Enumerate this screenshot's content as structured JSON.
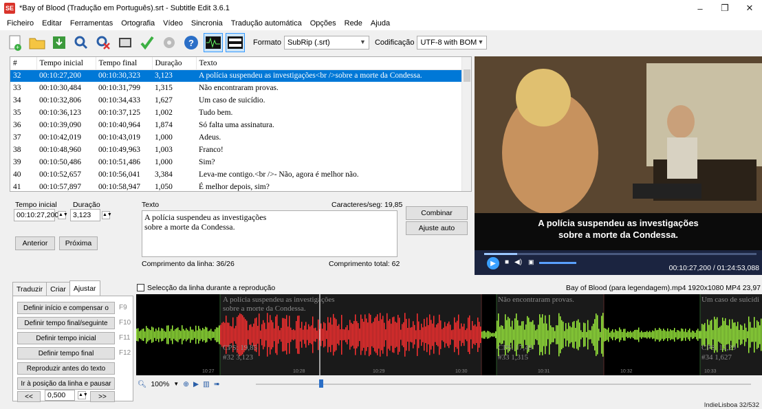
{
  "window": {
    "title": "*Bay of Blood (Tradução em Português).srt - Subtitle Edit 3.6.1",
    "app_badge": "SE",
    "minimize": "–",
    "maximize": "❐",
    "close": "✕"
  },
  "menu": [
    "Ficheiro",
    "Editar",
    "Ferramentas",
    "Ortografia",
    "Vídeo",
    "Sincronia",
    "Tradução automática",
    "Opções",
    "Rede",
    "Ajuda"
  ],
  "toolbar": {
    "format_label": "Formato",
    "format_value": "SubRip (.srt)",
    "encoding_label": "Codificação",
    "encoding_value": "UTF-8 with BOM"
  },
  "grid": {
    "headers": [
      "#",
      "Tempo inicial",
      "Tempo final",
      "Duração",
      "Texto"
    ],
    "rows": [
      [
        "32",
        "00:10:27,200",
        "00:10:30,323",
        "3,123",
        "A polícia suspendeu as investigações<br />sobre a morte da Condessa."
      ],
      [
        "33",
        "00:10:30,484",
        "00:10:31,799",
        "1,315",
        "Não encontraram provas."
      ],
      [
        "34",
        "00:10:32,806",
        "00:10:34,433",
        "1,627",
        "Um caso de suicídio."
      ],
      [
        "35",
        "00:10:36,123",
        "00:10:37,125",
        "1,002",
        "Tudo bem."
      ],
      [
        "36",
        "00:10:39,090",
        "00:10:40,964",
        "1,874",
        "Só falta uma assinatura."
      ],
      [
        "37",
        "00:10:42,019",
        "00:10:43,019",
        "1,000",
        "Adeus."
      ],
      [
        "38",
        "00:10:48,960",
        "00:10:49,963",
        "1,003",
        "Franco!"
      ],
      [
        "39",
        "00:10:50,486",
        "00:10:51,486",
        "1,000",
        "Sim?"
      ],
      [
        "40",
        "00:10:52,657",
        "00:10:56,041",
        "3,384",
        "Leva-me contigo.<br />- Não, agora é melhor não."
      ],
      [
        "41",
        "00:10:57,897",
        "00:10:58,947",
        "1,050",
        "É melhor depois, sim?"
      ]
    ]
  },
  "edit": {
    "start_label": "Tempo inicial",
    "start_value": "00:10:27,200",
    "duration_label": "Duração",
    "duration_value": "3,123",
    "text_label": "Texto",
    "cps_label": "Caracteres/seg: 19,85",
    "text_line1": "A polícia suspendeu as investigações",
    "text_line2": "sobre a morte da Condessa.",
    "line_length": "Comprimento da linha: 36/26",
    "total_length": "Comprimento total: 62",
    "btn_prev": "Anterior",
    "btn_next": "Próxima",
    "btn_merge": "Combinar",
    "btn_auto": "Ajuste auto"
  },
  "video": {
    "subtitle_line1": "A polícia suspendeu as investigações",
    "subtitle_line2": "sobre a morte da Condessa.",
    "time": "00:10:27,200 / 01:24:53,088",
    "progress": 0.12
  },
  "lower": {
    "tabs": [
      "Traduzir",
      "Criar",
      "Ajustar"
    ],
    "buttons": [
      {
        "label": "Definir início e compensar o",
        "key": "F9"
      },
      {
        "label": "Definir tempo final/seguinte",
        "key": "F10"
      },
      {
        "label": "Definir tempo inicial",
        "key": "F11"
      },
      {
        "label": "Definir tempo final",
        "key": "F12"
      },
      {
        "label": "Reproduzir antes do texto",
        "key": ""
      },
      {
        "label": "Ir à posição da linha e pausar",
        "key": ""
      }
    ],
    "step_prev": "<<",
    "step_value": "0,500",
    "step_next": ">>",
    "checkbox_label": "Selecção da linha durante a reprodução",
    "media_info": "Bay of Blood (para legendagem).mp4 1920x1080 MP4 23,97",
    "zoom": "100%"
  },
  "waveform": {
    "seg1_line1": "A polícia suspendeu as investigações",
    "seg1_line2": "sobre a morte da Condessa.",
    "seg1_cps": "CPS: 19,85",
    "seg1_info": "#32  3,123",
    "seg2_line1": "Não encontraram provas.",
    "seg2_cps": "CPS: 17,49",
    "seg2_info": "#33  1,315",
    "seg3_line1": "Um caso de suicídi",
    "seg3_cps": "CPS: 12,29",
    "seg3_info": "#34  1,627",
    "ticks": [
      "10:27",
      "10:28",
      "10:29",
      "10:30",
      "10:31",
      "10:32",
      "10:33"
    ]
  },
  "status": {
    "right": "IndieLisboa  32/532"
  }
}
